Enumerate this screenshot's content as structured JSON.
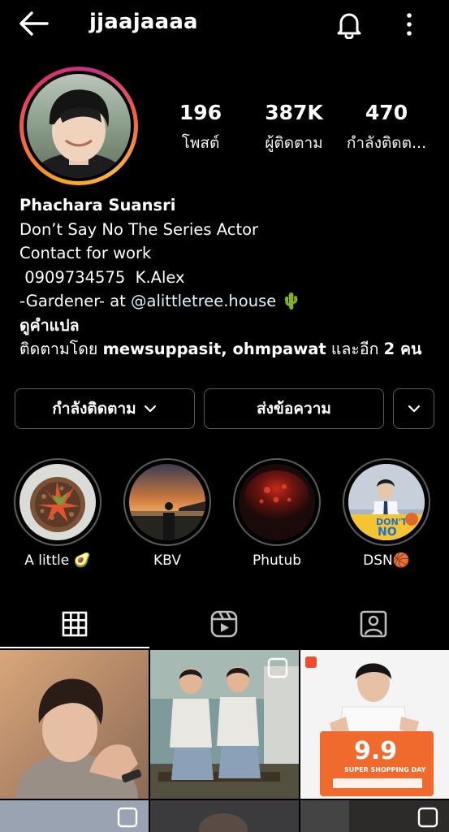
{
  "header": {
    "username": "jjaajaaaa"
  },
  "profile": {
    "stats": [
      {
        "value": "196",
        "label": "โพสต์"
      },
      {
        "value": "387K",
        "label": "ผู้ติดตาม"
      },
      {
        "value": "470",
        "label": "กำลังติดต..."
      }
    ],
    "name": "Phachara Suansri",
    "bio_lines": [
      "Don’t Say No The Series Actor",
      "Contact for work",
      " 0909734575  K.Alex"
    ],
    "gardener_prefix": "-Gardener- at ",
    "gardener_link": "@alittletree.house",
    "gardener_emoji": "🌵",
    "translate": "ดูคำแปล",
    "followed_by_prefix": "ติดตามโดย ",
    "followed_by_names": "mewsuppasit, ohmpawat",
    "followed_by_mid": " และอีก ",
    "followed_by_count": "2 คน"
  },
  "buttons": {
    "following": "กำลังติดตาม",
    "message": "ส่งข้อความ"
  },
  "highlights": [
    {
      "label": "A little 🥑"
    },
    {
      "label": "KBV"
    },
    {
      "label": "Phutub"
    },
    {
      "label": "DSN🏀"
    }
  ],
  "tabs": [
    "grid-icon",
    "reels-icon",
    "tagged-icon"
  ],
  "grid": {
    "dsn_logo_top": "DON'T",
    "dsn_logo_bottom": "NO",
    "promo_big": "9.9",
    "promo_small": "SUPER SHOPPING DAY"
  }
}
